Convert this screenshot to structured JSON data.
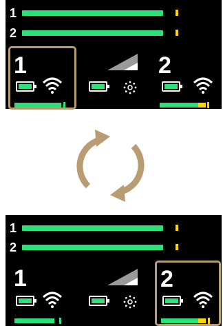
{
  "colors": {
    "panel_bg": "#000000",
    "active_green": "#2ee07a",
    "warning_yellow": "#ffd400",
    "highlight_border": "#b79c74",
    "arrow_color": "#b79c74"
  },
  "panels": [
    {
      "rows": [
        {
          "label": "1"
        },
        {
          "label": "2"
        }
      ],
      "devices": [
        {
          "label": "1",
          "highlighted": true,
          "battery_icon": "battery-icon",
          "connection_icon": "wifi-icon",
          "meter_fraction": 0.78
        },
        {
          "label": "",
          "highlighted": false,
          "battery_icon": "battery-icon",
          "connection_icon": "signal-strength-icon",
          "meter_fraction": 0
        },
        {
          "label": "2",
          "highlighted": false,
          "battery_icon": "battery-icon",
          "connection_icon": "wifi-icon",
          "meter_fraction": 0.8
        }
      ]
    },
    {
      "rows": [
        {
          "label": "1"
        },
        {
          "label": "2"
        }
      ],
      "devices": [
        {
          "label": "1",
          "highlighted": false,
          "battery_icon": "battery-icon",
          "connection_icon": "wifi-icon",
          "meter_fraction": 0.8
        },
        {
          "label": "",
          "highlighted": false,
          "battery_icon": "battery-icon",
          "connection_icon": "signal-strength-icon",
          "meter_fraction": 0
        },
        {
          "label": "2",
          "highlighted": true,
          "battery_icon": "battery-icon",
          "connection_icon": "wifi-icon",
          "meter_fraction": 0.8
        }
      ]
    }
  ],
  "center_icon": "cycle-arrows-icon"
}
